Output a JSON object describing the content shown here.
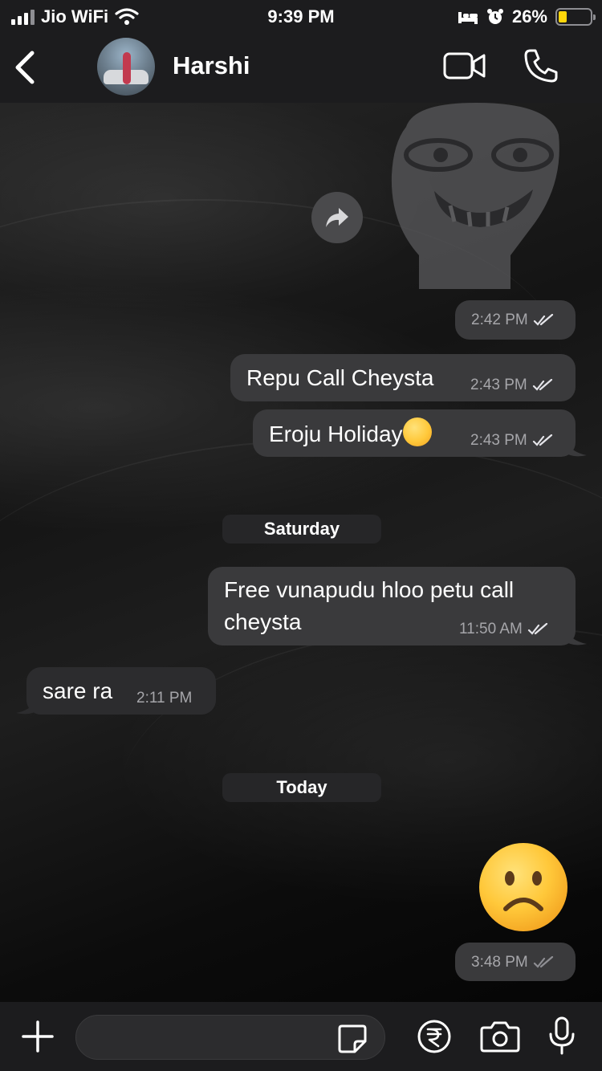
{
  "status_bar": {
    "carrier": "Jio WiFi",
    "time": "9:39 PM",
    "battery_percent": "26%",
    "battery_level": 0.26,
    "icons": [
      "signal-icon",
      "wifi-icon",
      "bed-icon",
      "alarm-icon",
      "battery-icon"
    ]
  },
  "header": {
    "contact_name": "Harshi",
    "icons": [
      "back-chevron-icon",
      "video-call-icon",
      "phone-call-icon"
    ]
  },
  "messages": [
    {
      "type": "sticker",
      "sender": "me",
      "time": "2:42 PM",
      "status": "read"
    },
    {
      "type": "text",
      "sender": "me",
      "text": "Repu Call Cheysta",
      "time": "2:43 PM",
      "status": "read"
    },
    {
      "type": "text",
      "sender": "me",
      "text": "Eroju Holiday",
      "emoji": "grinning-sweat-emoji",
      "time": "2:43 PM",
      "status": "read"
    },
    {
      "type": "date",
      "text": "Saturday"
    },
    {
      "type": "text",
      "sender": "me",
      "text_line1": "Free vunapudu hloo petu call",
      "text_line2": "cheysta",
      "time": "11:50 AM",
      "status": "read"
    },
    {
      "type": "text",
      "sender": "them",
      "text": "sare ra",
      "time": "2:11 PM"
    },
    {
      "type": "date",
      "text": "Today"
    },
    {
      "type": "emoji",
      "sender": "me",
      "emoji": "frowning-face-emoji",
      "time": "3:48 PM",
      "status": "delivered"
    }
  ],
  "composer": {
    "placeholder": "",
    "icons": [
      "plus-icon",
      "sticker-icon",
      "rupee-payment-icon",
      "camera-icon",
      "microphone-icon"
    ]
  },
  "colors": {
    "bar_bg": "#1c1c1e",
    "bubble_bg": "#3a3a3c",
    "battery_fill": "#ffd60a",
    "meta_text": "#a6a6aa"
  }
}
